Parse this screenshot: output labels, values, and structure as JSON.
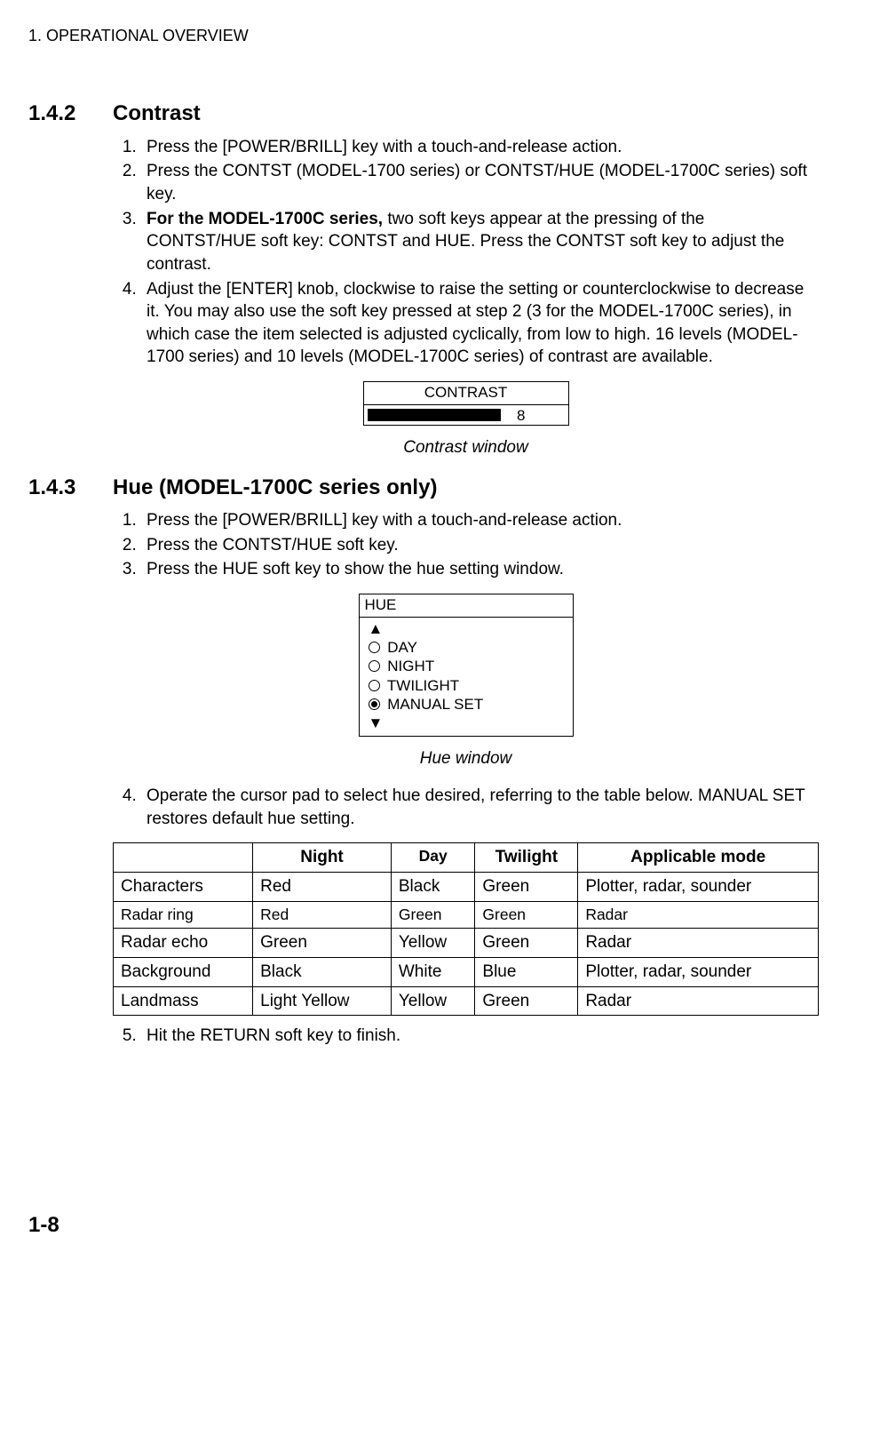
{
  "header": "1. OPERATIONAL OVERVIEW",
  "sec142": {
    "num": "1.4.2",
    "title": "Contrast",
    "steps": [
      " Press the [POWER/BRILL] key with a touch-and-release action.",
      "Press the CONTST (MODEL-1700 series) or CONTST/HUE (MODEL-1700C series) soft key.",
      "__HTML__<b>For the MODEL-1700C series,</b> two soft keys appear at the pressing of the CONTST/HUE soft key: CONTST and HUE. Press the CONTST soft key to adjust the contrast.",
      "Adjust the [ENTER] knob, clockwise to raise the setting or counterclockwise to decrease it. You may also use the soft key pressed at step 2 (3 for the MODEL-1700C series), in which case the item selected is adjusted cyclically, from low to high. 16 levels (MODEL-1700 series) and 10 levels (MODEL-1700C series) of contrast are available."
    ],
    "contrast_box": {
      "title": "CONTRAST",
      "value": "8"
    },
    "caption": "Contrast window"
  },
  "sec143": {
    "num": "1.4.3",
    "title": "Hue (MODEL-1700C series only)",
    "steps_a": [
      "Press the [POWER/BRILL] key with a touch-and-release action.",
      "Press the CONTST/HUE soft key.",
      "Press the HUE soft key to show the hue setting window."
    ],
    "hue_box": {
      "title": "HUE",
      "items": [
        {
          "label": "DAY",
          "selected": false
        },
        {
          "label": "NIGHT",
          "selected": false
        },
        {
          "label": "TWILIGHT",
          "selected": false
        },
        {
          "label": "MANUAL SET",
          "selected": true
        }
      ]
    },
    "caption": "Hue window",
    "step4": "Operate the cursor pad to select hue desired, referring to the table below. MANUAL SET restores default hue setting.",
    "step5": "Hit the RETURN soft key to finish.",
    "table": {
      "headers": [
        "",
        "Night",
        "Day",
        "Twilight",
        "Applicable mode"
      ],
      "rows": [
        {
          "cells": [
            "Characters",
            "Red",
            "Black",
            "Green",
            "Plotter, radar, sounder"
          ],
          "small": false
        },
        {
          "cells": [
            "Radar ring",
            "Red",
            "Green",
            "Green",
            "Radar"
          ],
          "small": true
        },
        {
          "cells": [
            "Radar echo",
            "Green",
            "Yellow",
            "Green",
            "Radar"
          ],
          "small": false
        },
        {
          "cells": [
            "Background",
            "Black",
            "White",
            "Blue",
            "Plotter, radar, sounder"
          ],
          "small": false
        },
        {
          "cells": [
            "Landmass",
            "Light Yellow",
            "Yellow",
            "Green",
            "Radar"
          ],
          "small": false
        }
      ]
    }
  },
  "page_num": "1-8"
}
